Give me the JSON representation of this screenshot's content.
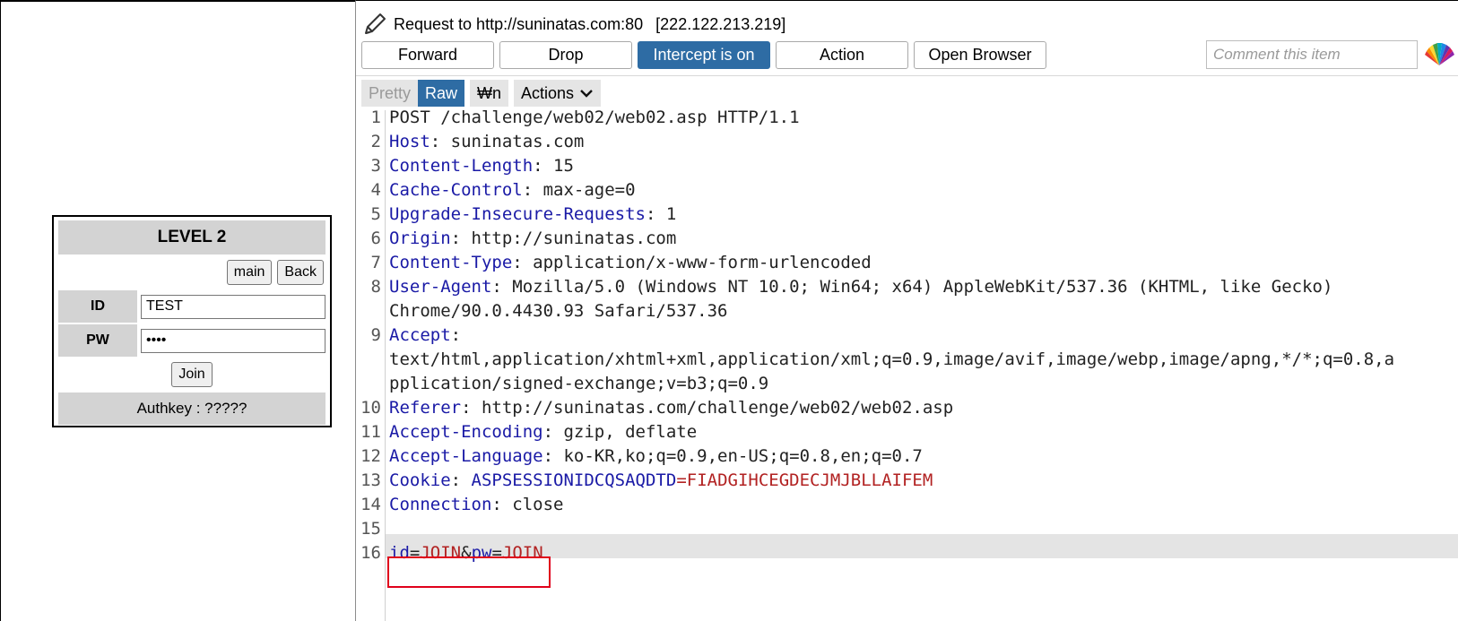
{
  "login_panel": {
    "title": "LEVEL 2",
    "main_label": "main",
    "back_label": "Back",
    "id_label": "ID",
    "id_value": "TEST",
    "pw_label": "PW",
    "pw_value": "••••",
    "join_label": "Join",
    "authkey_text": "Authkey : ?????"
  },
  "burp": {
    "request_title": "Request to http://suninatas.com:80",
    "request_ip": "[222.122.213.219]",
    "toolbar": {
      "forward": "Forward",
      "drop": "Drop",
      "intercept": "Intercept is on",
      "action": "Action",
      "open_browser": "Open Browser"
    },
    "comment_placeholder": "Comment this item",
    "subtabs": {
      "pretty": "Pretty",
      "raw": "Raw",
      "newline": "₩n",
      "actions": "Actions"
    },
    "lines": [
      {
        "n": "1",
        "plain": "POST /challenge/web02/web02.asp HTTP/1.1"
      },
      {
        "n": "2",
        "key": "Host",
        "rest": ": suninatas.com"
      },
      {
        "n": "3",
        "key": "Content-Length",
        "rest": ": 15"
      },
      {
        "n": "4",
        "key": "Cache-Control",
        "rest": ": max-age=0"
      },
      {
        "n": "5",
        "key": "Upgrade-Insecure-Requests",
        "rest": ": 1"
      },
      {
        "n": "6",
        "key": "Origin",
        "rest": ": http://suninatas.com"
      },
      {
        "n": "7",
        "key": "Content-Type",
        "rest": ": application/x-www-form-urlencoded"
      },
      {
        "n": "8",
        "key": "User-Agent",
        "rest": ": Mozilla/5.0 (Windows NT 10.0; Win64; x64) AppleWebKit/537.36 (KHTML, like Gecko)"
      },
      {
        "n": "",
        "plain": "Chrome/90.0.4430.93 Safari/537.36"
      },
      {
        "n": "9",
        "key": "Accept",
        "rest": ":"
      },
      {
        "n": "",
        "plain": "text/html,application/xhtml+xml,application/xml;q=0.9,image/avif,image/webp,image/apng,*/*;q=0.8,a"
      },
      {
        "n": "",
        "plain": "pplication/signed-exchange;v=b3;q=0.9"
      },
      {
        "n": "10",
        "key": "Referer",
        "rest": ": http://suninatas.com/challenge/web02/web02.asp"
      },
      {
        "n": "11",
        "key": "Accept-Encoding",
        "rest": ": gzip, deflate"
      },
      {
        "n": "12",
        "key": "Accept-Language",
        "rest": ": ko-KR,ko;q=0.9,en-US;q=0.8,en;q=0.7"
      },
      {
        "n": "13",
        "key": "Cookie",
        "rest": ": ",
        "ckey": "ASPSESSIONIDCQSAQDTD",
        "eq": "=",
        "cval": "FIADGIHCEGDECJMJBLLAIFEM"
      },
      {
        "n": "14",
        "key": "Connection",
        "rest": ": close"
      },
      {
        "n": "15",
        "plain": ""
      },
      {
        "n": "16",
        "body": true,
        "k1": "id",
        "e1": "=",
        "v1": "JOIN",
        "amp": "&",
        "k2": "pw",
        "e2": "=",
        "v2": "JOIN"
      }
    ]
  }
}
